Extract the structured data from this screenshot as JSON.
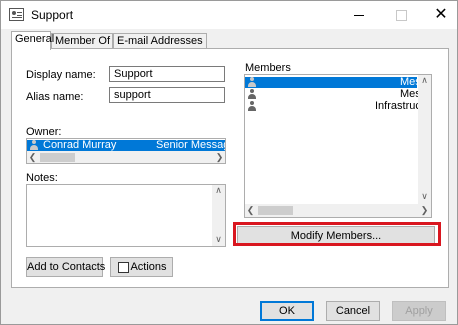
{
  "window": {
    "title": "Support",
    "close_glyph": "✕"
  },
  "tabs": [
    {
      "label": "General",
      "active": true
    },
    {
      "label": "Member Of",
      "active": false
    },
    {
      "label": "E-mail Addresses",
      "active": false
    }
  ],
  "general": {
    "display_name_label": "Display name:",
    "display_name_value": "Support",
    "alias_label": "Alias name:",
    "alias_value": "support",
    "owner_label": "Owner:",
    "owner": {
      "name": "Conrad Murray",
      "title": "Senior Messaging"
    },
    "notes_label": "Notes:",
    "notes_value": "",
    "members_label": "Members",
    "members": [
      {
        "name": "",
        "detail": "Mes",
        "selected": true
      },
      {
        "name": "",
        "detail": "Mes",
        "selected": false
      },
      {
        "name": "",
        "detail": "Infrastructu",
        "selected": false
      }
    ],
    "modify_members_label": "Modify Members...",
    "add_to_contacts_label": "Add to Contacts",
    "actions_label": "Actions"
  },
  "footer": {
    "ok_label": "OK",
    "cancel_label": "Cancel",
    "apply_label": "Apply"
  },
  "icons": {
    "title": "contact-card-icon",
    "owner": "person-icon",
    "members": "person-icon",
    "scroll_left": "arrow-left-icon",
    "scroll_right": "arrow-right-icon",
    "scroll_up": "arrow-up-icon",
    "scroll_down": "arrow-down-icon"
  },
  "colors": {
    "selection": "#0078d7",
    "highlight_box": "#d9161f"
  }
}
